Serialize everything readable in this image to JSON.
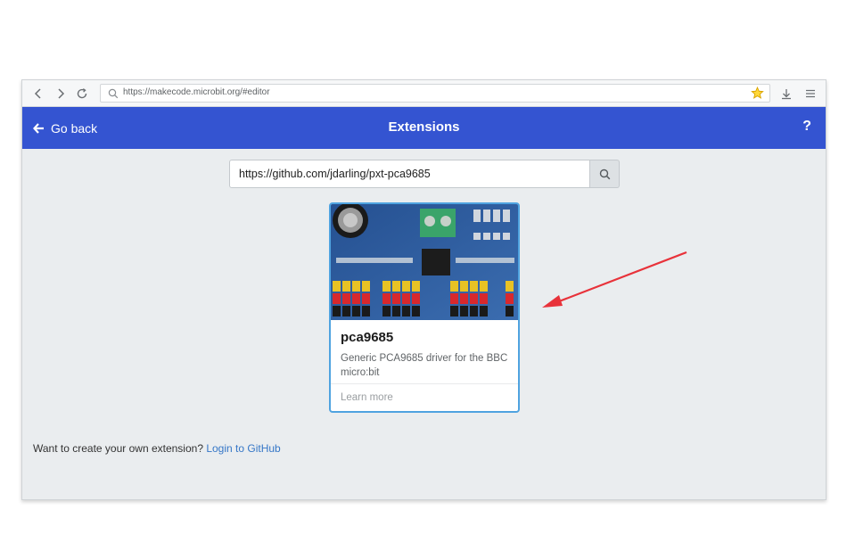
{
  "browser": {
    "url": "https://makecode.microbit.org/#editor",
    "back_icon": "chevron-left-icon",
    "forward_icon": "chevron-right-icon",
    "reload_icon": "reload-icon",
    "bookmark_icon": "star-icon",
    "download_icon": "download-icon",
    "menu_icon": "hamburger-menu-icon"
  },
  "header": {
    "back_label": "Go back",
    "title": "Extensions",
    "help": "?",
    "color": "#3454d1"
  },
  "search": {
    "value": "https://github.com/jdarling/pxt-pca9685",
    "icon": "search-icon"
  },
  "card": {
    "title": "pca9685",
    "description": "Generic PCA9685 driver for the BBC micro:bit",
    "learn_more": "Learn more",
    "border_color": "#4fa3e0"
  },
  "footer": {
    "text": "Want to create your own extension? ",
    "link": "Login to GitHub"
  },
  "annotation": {
    "color": "#e8323a"
  }
}
